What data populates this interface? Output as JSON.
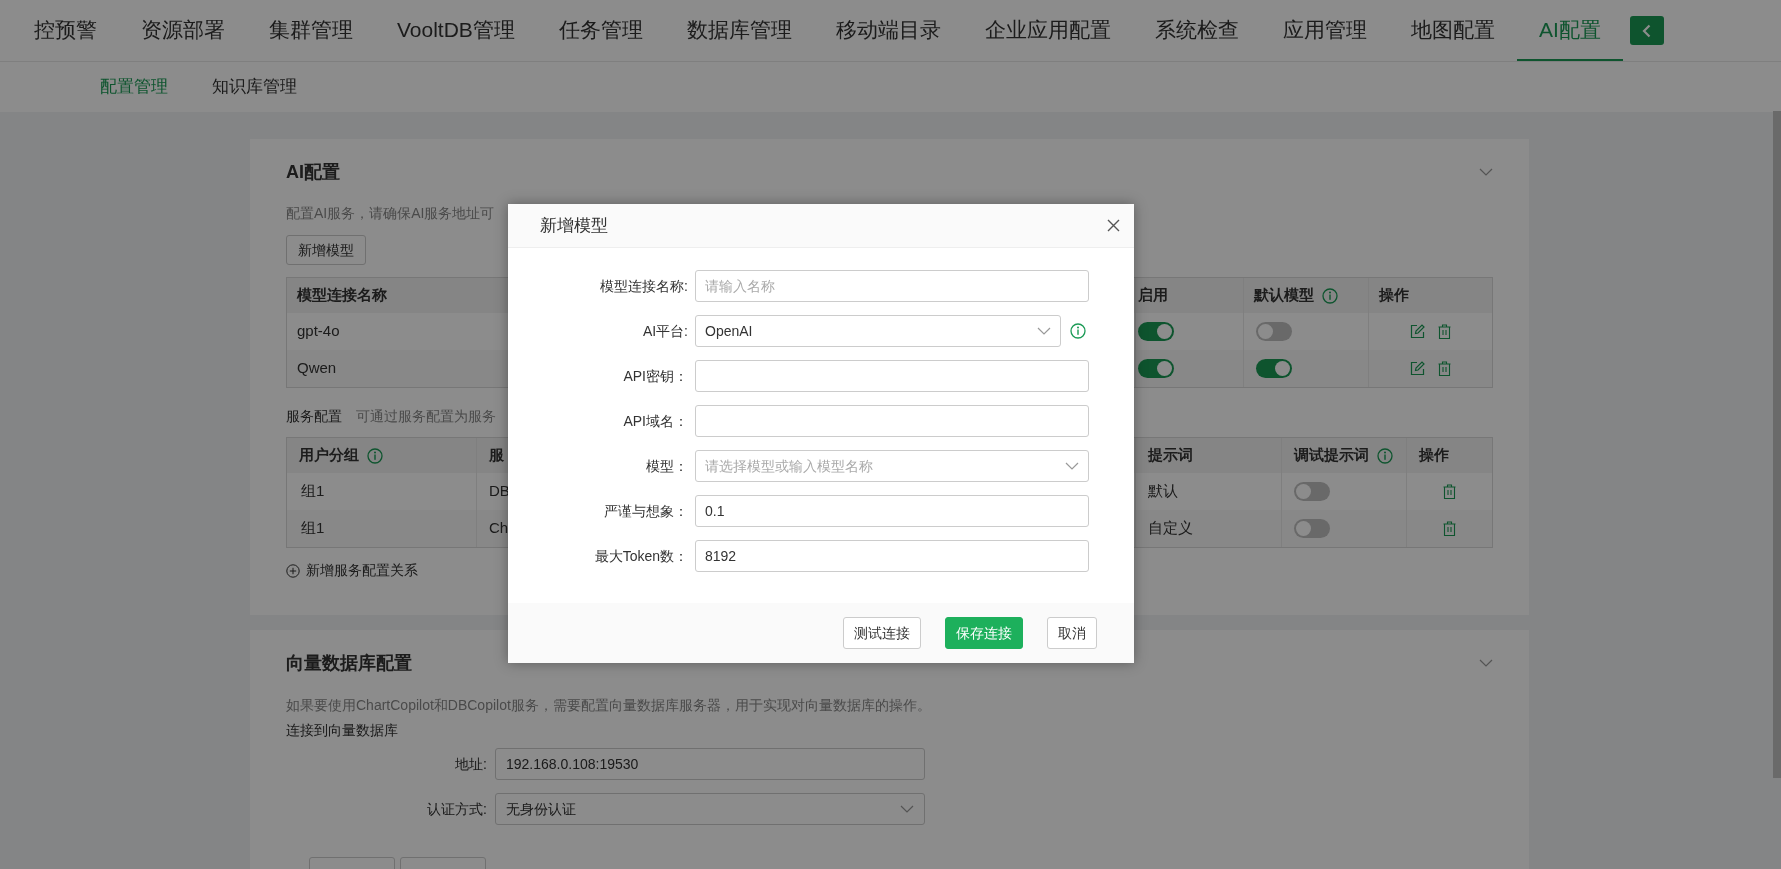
{
  "top_nav": {
    "tabs": [
      {
        "label": "控预警",
        "selected": false
      },
      {
        "label": "资源部署",
        "selected": false
      },
      {
        "label": "集群管理",
        "selected": false
      },
      {
        "label": "VooltDB管理",
        "selected": false
      },
      {
        "label": "任务管理",
        "selected": false
      },
      {
        "label": "数据库管理",
        "selected": false
      },
      {
        "label": "移动端目录",
        "selected": false
      },
      {
        "label": "企业应用配置",
        "selected": false
      },
      {
        "label": "系统检查",
        "selected": false
      },
      {
        "label": "应用管理",
        "selected": false
      },
      {
        "label": "地图配置",
        "selected": false
      },
      {
        "label": "AI配置",
        "selected": true
      }
    ]
  },
  "sub_nav": {
    "tabs": [
      {
        "label": "配置管理",
        "selected": true
      },
      {
        "label": "知识库管理",
        "selected": false
      }
    ]
  },
  "ai_config": {
    "title": "AI配置",
    "description": "配置AI服务，请确保AI服务地址可",
    "add_button": "新增模型",
    "model_table": {
      "columns": [
        {
          "label": "模型连接名称",
          "info": false
        },
        {
          "label": "启用",
          "info": false
        },
        {
          "label": "默认模型",
          "info": true
        },
        {
          "label": "操作",
          "info": false
        }
      ],
      "rows": [
        {
          "name": "gpt-4o",
          "enabled": true,
          "default": false
        },
        {
          "name": "Qwen",
          "enabled": true,
          "default": true
        }
      ]
    },
    "service_label": "服务配置",
    "service_hint": "可通过服务配置为服务",
    "service_table": {
      "columns": [
        {
          "label": "用户分组",
          "info": true
        },
        {
          "label": "服"
        },
        {
          "label": "提示词",
          "info": false
        },
        {
          "label": "调试提示词",
          "info": true
        },
        {
          "label": "操作",
          "info": false
        }
      ],
      "rows": [
        {
          "group": "组1",
          "service": "DB",
          "prompt": "默认",
          "debug_prompt": false
        },
        {
          "group": "组1",
          "service": "Ch",
          "prompt": "自定义",
          "debug_prompt": false
        }
      ]
    },
    "add_relation": "新增服务配置关系"
  },
  "vector_db": {
    "title": "向量数据库配置",
    "description": "如果要使用ChartCopilot和DBCopilot服务，需要配置向量数据库服务器，用于实现对向量数据库的操作。",
    "subheading": "连接到向量数据库",
    "fields": [
      {
        "kind": "input",
        "label": "地址:",
        "value": "192.168.0.108:19530"
      },
      {
        "kind": "select",
        "label": "认证方式:",
        "value": "无身份认证"
      }
    ]
  },
  "dialog": {
    "title": "新增模型",
    "fields": [
      {
        "kind": "input",
        "label": "模型连接名称:",
        "placeholder": "请输入名称",
        "info": false
      },
      {
        "kind": "select",
        "label": "AI平台:",
        "value": "OpenAI",
        "info": true
      },
      {
        "kind": "input",
        "label": "API密钥：",
        "info": false
      },
      {
        "kind": "input",
        "label": "API域名：",
        "info": false
      },
      {
        "kind": "select",
        "label": "模型：",
        "placeholder": "请选择模型或输入模型名称",
        "info": false
      },
      {
        "kind": "input",
        "label": "严谨与想象：",
        "value": "0.1",
        "info": false
      },
      {
        "kind": "input",
        "label": "最大Token数：",
        "value": "8192",
        "info": false
      }
    ],
    "buttons": [
      {
        "label": "测试连接",
        "primary": false
      },
      {
        "label": "保存连接",
        "primary": true
      },
      {
        "label": "取消",
        "primary": false
      }
    ]
  }
}
